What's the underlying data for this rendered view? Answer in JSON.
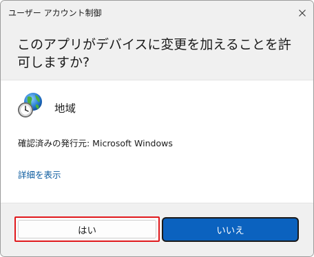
{
  "window": {
    "title": "ユーザー アカウント制御"
  },
  "prompt": {
    "question": "このアプリがデバイスに変更を加えることを許可しますか?"
  },
  "app": {
    "icon": "globe-clock-icon",
    "name": "地域",
    "publisher": "確認済みの発行元: Microsoft Windows"
  },
  "links": {
    "details": "詳細を表示"
  },
  "buttons": {
    "yes": "はい",
    "no": "いいえ"
  },
  "colors": {
    "accent": "#0b62bf",
    "highlight": "#e0171b",
    "link": "#0a5a9e"
  }
}
